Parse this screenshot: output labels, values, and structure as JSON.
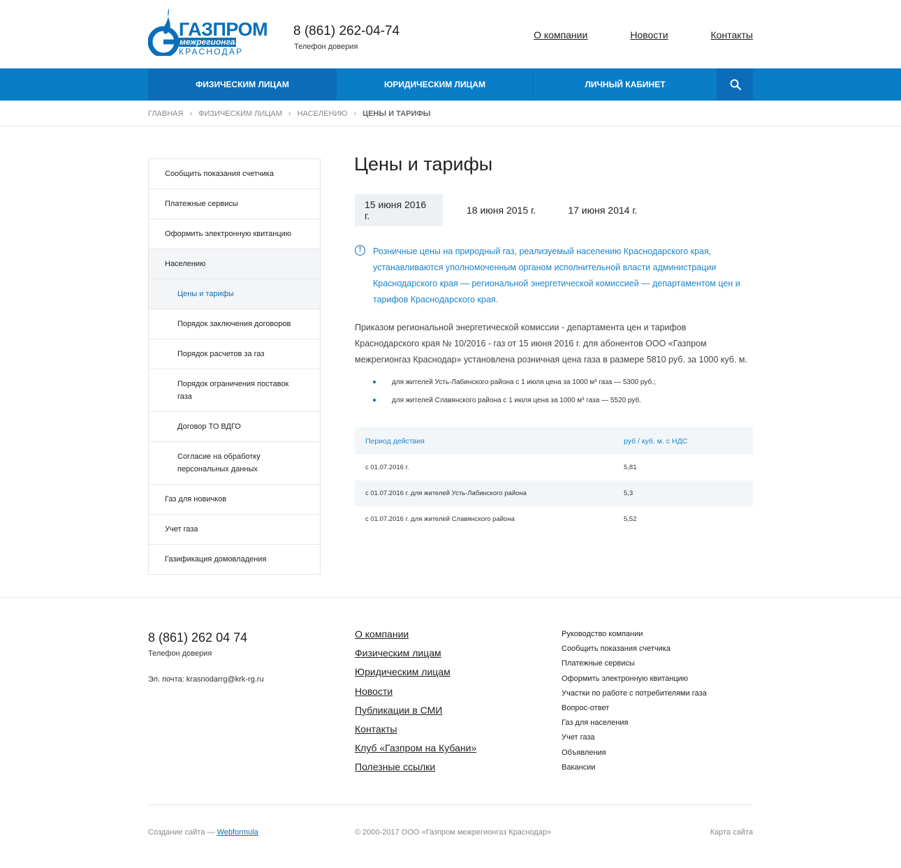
{
  "header": {
    "logo": {
      "line1": "ГАЗПРОМ",
      "line2": "межрегионгаз",
      "line3": "КРАСНОДАР"
    },
    "phone": "8 (861) 262-04-74",
    "phone_label": "Телефон доверия",
    "nav": [
      "О компании",
      "Новости",
      "Контакты"
    ]
  },
  "menu": {
    "items": [
      "Физическим лицам",
      "Юридическим лицам",
      "Личный кабинет"
    ],
    "search_icon": "search-icon"
  },
  "breadcrumb": [
    "Главная",
    "Физическим лицам",
    "Населению",
    "Цены и тарифы"
  ],
  "sidebar": [
    {
      "label": "Сообщить показания счетчика"
    },
    {
      "label": "Платежные сервисы"
    },
    {
      "label": "Оформить электронную квитанцию"
    },
    {
      "label": "Населению"
    },
    {
      "label": "Цены и тарифы"
    },
    {
      "label": "Порядок заключения договоров"
    },
    {
      "label": "Порядок расчетов за газ"
    },
    {
      "label": "Порядок ограничения поставок газа"
    },
    {
      "label": "Договор ТО ВДГО"
    },
    {
      "label": "Согласие на обработку персональных данных"
    },
    {
      "label": "Газ для новичков"
    },
    {
      "label": "Учет газа"
    },
    {
      "label": "Газификация домовладения"
    }
  ],
  "main": {
    "title": "Цены и тарифы",
    "tabs": [
      "15 июня 2016 г.",
      "18 июня 2015 г.",
      "17 июня 2014 г."
    ],
    "notice": "Розничные цены на природный газ, реализуемый населению Краснодарского края, устанавливаются уполномоченным органом исполнительной власти администрации Краснодарского края — региональной энергетической комиссией — департаментом цен и тарифов Краснодарского края.",
    "paragraph": "Приказом региональной энергетической комиссии - департамента цен и тарифов Краснодарского края  № 10/2016 - газ от 15 июня 2016 г. для абонентов ООО «Газпром межрегионгаз Краснодар» установлена розничная цена газа в размере 5810 руб. за 1000 куб. м.",
    "bullets": [
      "для жителей Усть-Лабинского района с 1 июля цена за 1000 м³ газа — 5300 руб.;",
      "для жителей  Славянского района с 1 июля цена за 1000 м³ газа — 5520 руб."
    ],
    "table": {
      "headers": [
        "Период действия",
        "руб / куб. м. с НДС"
      ],
      "rows": [
        [
          "с 01.07.2016 г.",
          "5,81"
        ],
        [
          "с 01.07.2016 г. для жителей Усть-Лабинского района",
          "5,3"
        ],
        [
          "с 01.07.2016 г. для жителей Славянского района",
          "5,52"
        ]
      ]
    }
  },
  "footer": {
    "phone": "8 (861) 262 04 74",
    "phone_label": "Телефон доверия",
    "email": "Эл. почта: krasnodarrg@krk-rg.ru",
    "links": [
      "О компании",
      "Физическим лицам",
      "Юридическим лицам",
      "Новости",
      "Публикации в СМИ",
      "Контакты",
      "Клуб «Газпром на Кубани»",
      "Полезные ссылки"
    ],
    "links2": [
      "Руководство компании",
      "Сообщить показания счетчика",
      "Платежные сервисы",
      "Оформить электронную квитанцию",
      "Участки по работе с потребителями газа",
      "Вопрос-ответ",
      "Газ для населения",
      "Учет газа",
      "Объявления",
      "Вакансии"
    ],
    "credit_prefix": "Создание сайта — ",
    "credit_link": "Webformula",
    "copyright": "© 2000-2017 ООО «Газпром межрегионгаз Краснодар»",
    "sitemap": "Карта сайта"
  },
  "colors": {
    "brand": "#0a7dc8",
    "brand_dark": "#0b6cba",
    "link": "#1d84c6"
  }
}
